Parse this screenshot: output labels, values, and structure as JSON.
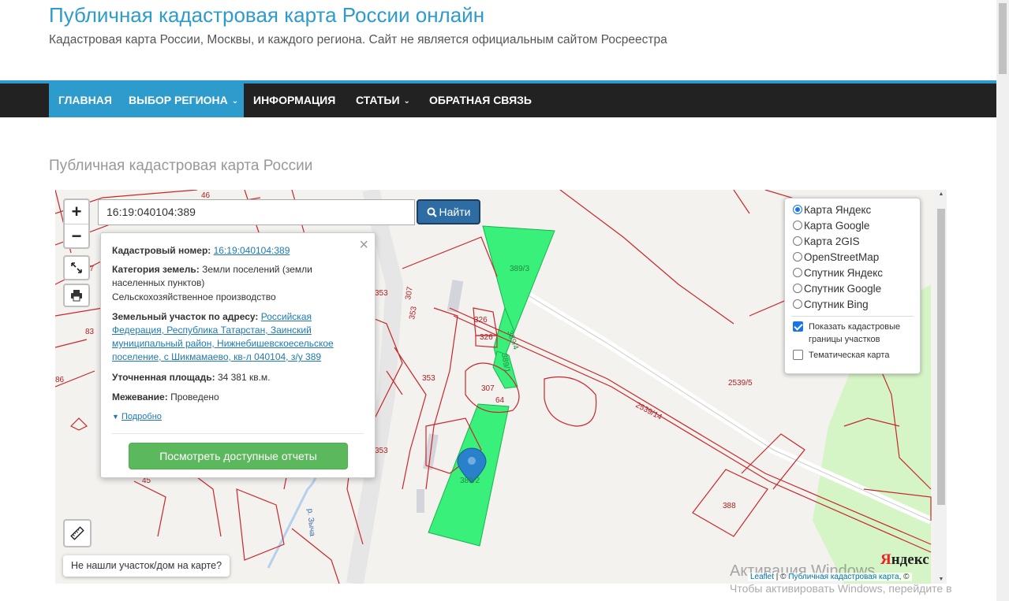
{
  "site": {
    "title": "Публичная кадастровая карта России онлайн",
    "description": "Кадастровая карта России, Москвы, и каждого региона. Сайт не является официальным сайтом Росреестра"
  },
  "nav": {
    "home": "ГЛАВНАЯ",
    "region": "ВЫБОР РЕГИОНА",
    "info": "ИНФОРМАЦИЯ",
    "articles": "СТАТЬИ",
    "feedback": "ОБРАТНАЯ СВЯЗЬ",
    "caret": "⌄"
  },
  "section_title": "Публичная кадастровая карта России",
  "map": {
    "zoom_in": "+",
    "zoom_out": "−",
    "search_value": "16:19:040104:389",
    "search_button": "Найти",
    "not_found_label": "Не нашли участок/дом на карте?",
    "attribution_leaflet": "Leaflet",
    "attribution_sep": " | © ",
    "attribution_link": "Публичная кадастровая карта",
    "attribution_tail": ", ©",
    "yandex_logo_y": "Я",
    "yandex_logo_rest": "ндекс",
    "labels": {
      "l353a": "353",
      "l307a": "307",
      "l353b": "353",
      "l326a": "326",
      "l326b": "326",
      "l3893": "389/3",
      "l3894": "389/4",
      "l3891": "389/1",
      "l353c": "353",
      "l307b": "307",
      "l64": "64",
      "l353d": "353",
      "l3892": "389/2",
      "l25395": "2539/5",
      "l253914": "2539/14",
      "l388": "388",
      "river": "р. Зыча",
      "l46": "46",
      "l83": "83",
      "l86": "86",
      "l45": "45",
      "l37": "37"
    }
  },
  "popup": {
    "close": "×",
    "cad_label": "Кадастровый номер:",
    "cad_value": "16:19:040104:389",
    "category_label": "Категория земель:",
    "category_value": "Земли поселений (земли населенных пунктов)",
    "usage_value": "Сельскохозяйственное производство",
    "address_label": "Земельный участок по адресу:",
    "address_value": "Российская Федерация, Республика Татарстан, Заинский муниципальный район, Нижнебишевскоесельское поселение, с Шикмамаево, кв-л 040104, з/у 389",
    "area_label": "Уточненная площадь:",
    "area_value": "34 381 кв.м.",
    "survey_label": "Межевание:",
    "survey_value": "Проведено",
    "more_link": "Подробно",
    "reports_button": "Посмотреть доступные отчеты"
  },
  "layers": {
    "options": [
      {
        "label": "Карта Яндекс",
        "selected": true
      },
      {
        "label": "Карта Google",
        "selected": false
      },
      {
        "label": "Карта 2GIS",
        "selected": false
      },
      {
        "label": "OpenStreetMap",
        "selected": false
      },
      {
        "label": "Спутник Яндекс",
        "selected": false
      },
      {
        "label": "Спутник Google",
        "selected": false
      },
      {
        "label": "Спутник Bing",
        "selected": false
      }
    ],
    "show_cadastral": "Показать кадастровые границы участков",
    "show_cadastral_checked": true,
    "thematic": "Тематическая карта",
    "thematic_checked": false
  },
  "windows_watermark": {
    "line1": "Активация Windows",
    "line2": "Чтобы активировать Windows, перейдите в"
  },
  "colors": {
    "accent": "#2d9bcc",
    "nav_bg": "#222222",
    "parcel_green": "#39f07a",
    "parcel_line": "#c8272b",
    "report_button": "#5cb85c",
    "search_button": "#2e6da4"
  }
}
